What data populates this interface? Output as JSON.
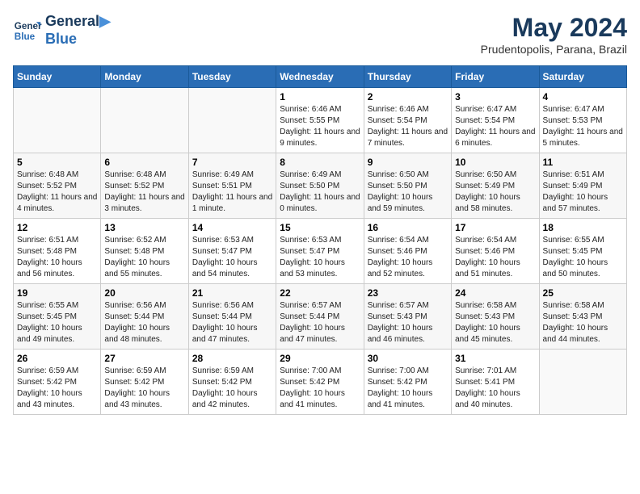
{
  "header": {
    "logo": {
      "line1": "General",
      "line2": "Blue"
    },
    "title": "May 2024",
    "subtitle": "Prudentopolis, Parana, Brazil"
  },
  "weekdays": [
    "Sunday",
    "Monday",
    "Tuesday",
    "Wednesday",
    "Thursday",
    "Friday",
    "Saturday"
  ],
  "weeks": [
    [
      {
        "day": "",
        "info": ""
      },
      {
        "day": "",
        "info": ""
      },
      {
        "day": "",
        "info": ""
      },
      {
        "day": "1",
        "info": "Sunrise: 6:46 AM\nSunset: 5:55 PM\nDaylight: 11 hours and 9 minutes."
      },
      {
        "day": "2",
        "info": "Sunrise: 6:46 AM\nSunset: 5:54 PM\nDaylight: 11 hours and 7 minutes."
      },
      {
        "day": "3",
        "info": "Sunrise: 6:47 AM\nSunset: 5:54 PM\nDaylight: 11 hours and 6 minutes."
      },
      {
        "day": "4",
        "info": "Sunrise: 6:47 AM\nSunset: 5:53 PM\nDaylight: 11 hours and 5 minutes."
      }
    ],
    [
      {
        "day": "5",
        "info": "Sunrise: 6:48 AM\nSunset: 5:52 PM\nDaylight: 11 hours and 4 minutes."
      },
      {
        "day": "6",
        "info": "Sunrise: 6:48 AM\nSunset: 5:52 PM\nDaylight: 11 hours and 3 minutes."
      },
      {
        "day": "7",
        "info": "Sunrise: 6:49 AM\nSunset: 5:51 PM\nDaylight: 11 hours and 1 minute."
      },
      {
        "day": "8",
        "info": "Sunrise: 6:49 AM\nSunset: 5:50 PM\nDaylight: 11 hours and 0 minutes."
      },
      {
        "day": "9",
        "info": "Sunrise: 6:50 AM\nSunset: 5:50 PM\nDaylight: 10 hours and 59 minutes."
      },
      {
        "day": "10",
        "info": "Sunrise: 6:50 AM\nSunset: 5:49 PM\nDaylight: 10 hours and 58 minutes."
      },
      {
        "day": "11",
        "info": "Sunrise: 6:51 AM\nSunset: 5:49 PM\nDaylight: 10 hours and 57 minutes."
      }
    ],
    [
      {
        "day": "12",
        "info": "Sunrise: 6:51 AM\nSunset: 5:48 PM\nDaylight: 10 hours and 56 minutes."
      },
      {
        "day": "13",
        "info": "Sunrise: 6:52 AM\nSunset: 5:48 PM\nDaylight: 10 hours and 55 minutes."
      },
      {
        "day": "14",
        "info": "Sunrise: 6:53 AM\nSunset: 5:47 PM\nDaylight: 10 hours and 54 minutes."
      },
      {
        "day": "15",
        "info": "Sunrise: 6:53 AM\nSunset: 5:47 PM\nDaylight: 10 hours and 53 minutes."
      },
      {
        "day": "16",
        "info": "Sunrise: 6:54 AM\nSunset: 5:46 PM\nDaylight: 10 hours and 52 minutes."
      },
      {
        "day": "17",
        "info": "Sunrise: 6:54 AM\nSunset: 5:46 PM\nDaylight: 10 hours and 51 minutes."
      },
      {
        "day": "18",
        "info": "Sunrise: 6:55 AM\nSunset: 5:45 PM\nDaylight: 10 hours and 50 minutes."
      }
    ],
    [
      {
        "day": "19",
        "info": "Sunrise: 6:55 AM\nSunset: 5:45 PM\nDaylight: 10 hours and 49 minutes."
      },
      {
        "day": "20",
        "info": "Sunrise: 6:56 AM\nSunset: 5:44 PM\nDaylight: 10 hours and 48 minutes."
      },
      {
        "day": "21",
        "info": "Sunrise: 6:56 AM\nSunset: 5:44 PM\nDaylight: 10 hours and 47 minutes."
      },
      {
        "day": "22",
        "info": "Sunrise: 6:57 AM\nSunset: 5:44 PM\nDaylight: 10 hours and 47 minutes."
      },
      {
        "day": "23",
        "info": "Sunrise: 6:57 AM\nSunset: 5:43 PM\nDaylight: 10 hours and 46 minutes."
      },
      {
        "day": "24",
        "info": "Sunrise: 6:58 AM\nSunset: 5:43 PM\nDaylight: 10 hours and 45 minutes."
      },
      {
        "day": "25",
        "info": "Sunrise: 6:58 AM\nSunset: 5:43 PM\nDaylight: 10 hours and 44 minutes."
      }
    ],
    [
      {
        "day": "26",
        "info": "Sunrise: 6:59 AM\nSunset: 5:42 PM\nDaylight: 10 hours and 43 minutes."
      },
      {
        "day": "27",
        "info": "Sunrise: 6:59 AM\nSunset: 5:42 PM\nDaylight: 10 hours and 43 minutes."
      },
      {
        "day": "28",
        "info": "Sunrise: 6:59 AM\nSunset: 5:42 PM\nDaylight: 10 hours and 42 minutes."
      },
      {
        "day": "29",
        "info": "Sunrise: 7:00 AM\nSunset: 5:42 PM\nDaylight: 10 hours and 41 minutes."
      },
      {
        "day": "30",
        "info": "Sunrise: 7:00 AM\nSunset: 5:42 PM\nDaylight: 10 hours and 41 minutes."
      },
      {
        "day": "31",
        "info": "Sunrise: 7:01 AM\nSunset: 5:41 PM\nDaylight: 10 hours and 40 minutes."
      },
      {
        "day": "",
        "info": ""
      }
    ]
  ]
}
